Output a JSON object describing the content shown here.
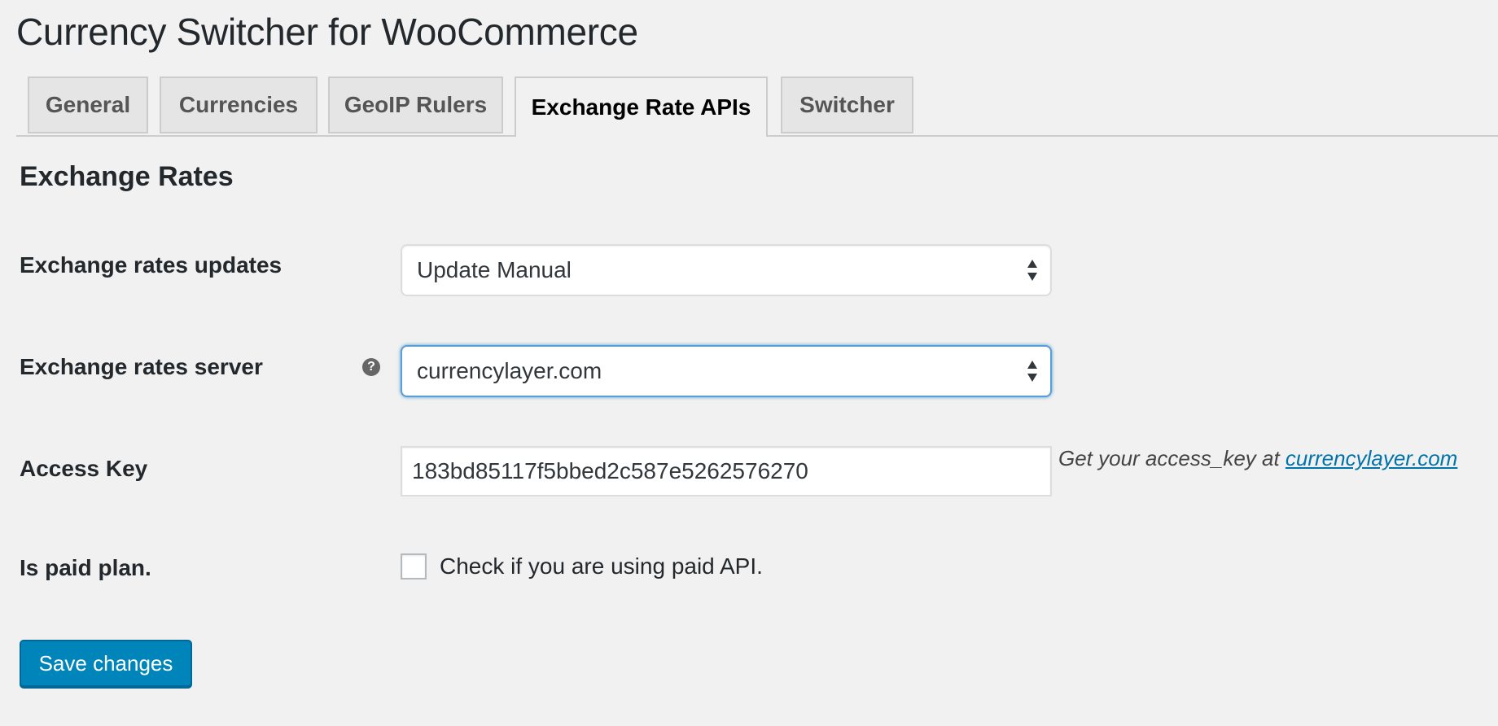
{
  "page": {
    "title": "Currency Switcher for WooCommerce"
  },
  "tabs": [
    {
      "label": "General",
      "active": false
    },
    {
      "label": "Currencies",
      "active": false
    },
    {
      "label": "GeoIP Rulers",
      "active": false
    },
    {
      "label": "Exchange Rate APIs",
      "active": true
    },
    {
      "label": "Switcher",
      "active": false
    }
  ],
  "section": {
    "title": "Exchange Rates"
  },
  "fields": {
    "updates": {
      "label": "Exchange rates updates",
      "value": "Update Manual"
    },
    "server": {
      "label": "Exchange rates server",
      "value": "currencylayer.com",
      "help_icon": "?"
    },
    "access_key": {
      "label": "Access Key",
      "value": "183bd85117f5bbed2c587e5262576270",
      "description": "Get your access_key at ",
      "link_text": "currencylayer.com"
    },
    "paid_plan": {
      "label": "Is paid plan.",
      "checkbox_label": "Check if you are using paid API.",
      "checked": false
    }
  },
  "actions": {
    "save_label": "Save changes"
  },
  "colors": {
    "background": "#f1f1f1",
    "primary_button": "#0085ba",
    "link": "#0073aa",
    "focus_border": "#5b9dd9"
  },
  "icons": {
    "help": "question-circle-icon",
    "select_arrows": "updown-arrows-icon"
  }
}
